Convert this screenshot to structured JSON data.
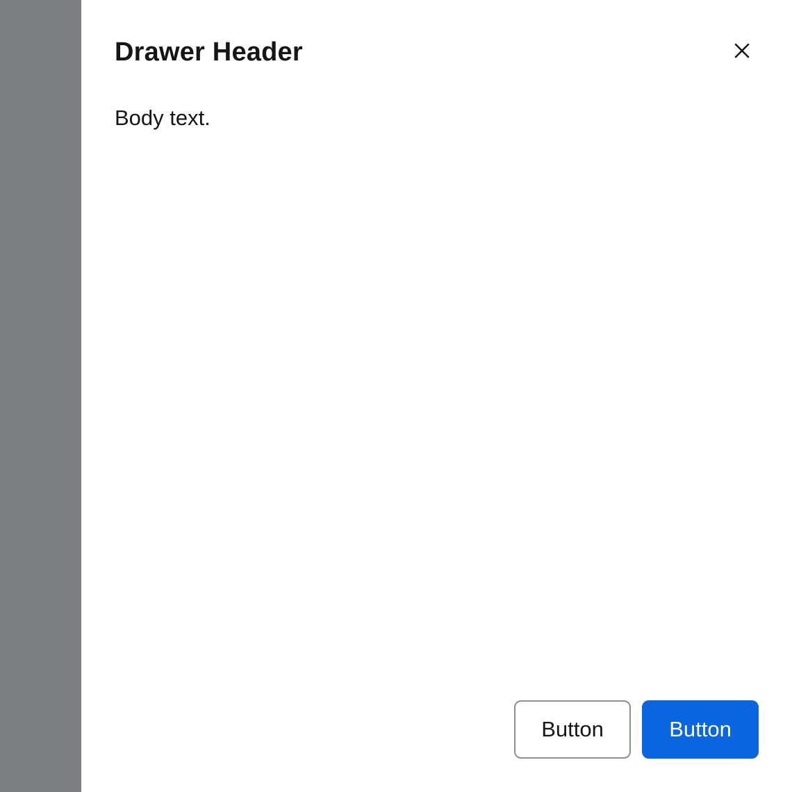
{
  "drawer": {
    "title": "Drawer Header",
    "body_text": "Body text.",
    "close_icon": "close-icon",
    "footer": {
      "secondary_label": "Button",
      "primary_label": "Button"
    }
  },
  "colors": {
    "backdrop": "#7d7e80",
    "primary_button": "#0a66e0",
    "secondary_border": "#8e8e90",
    "text": "#161616"
  }
}
